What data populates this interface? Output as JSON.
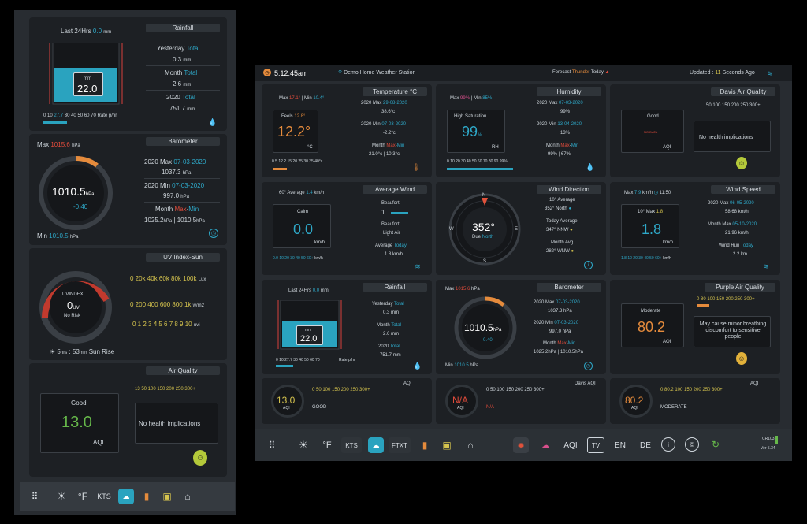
{
  "left": {
    "rainfall": {
      "title": "Rainfall",
      "last24_label": "Last 24Hrs",
      "last24_value": "0.0",
      "last24_unit": "mm",
      "gauge_unit": "mm",
      "gauge_value": "22.0",
      "scale": [
        "0",
        "10",
        "27.7",
        "30",
        "40",
        "50",
        "60",
        "70"
      ],
      "scale_label": "Rate p/hr",
      "yesterday_label": "Yesterday",
      "yesterday_total": "Total",
      "yesterday_value": "0.3",
      "month_label": "Month",
      "month_total": "Total",
      "month_value": "2.6",
      "year_label": "2020",
      "year_total": "Total",
      "year_value": "751.7",
      "unit": "mm"
    },
    "barometer": {
      "title": "Barometer",
      "max_label": "Max",
      "max_value": "1015.6",
      "unit": "hPa",
      "value": "1010.5",
      "value_unit": "hPa",
      "trend": "-0.40",
      "min_label": "Min",
      "min_value": "1010.5",
      "year_max_label": "2020 Max",
      "year_max_date": "07-03-2020",
      "year_max_value": "1037.3",
      "year_min_label": "2020 Min",
      "year_min_date": "07-03-2020",
      "year_min_value": "997.0",
      "month_label": "Month",
      "month_max": "Max",
      "month_sep": "-",
      "month_min": "Min",
      "month_max_value": "1025.2",
      "month_min_value": "1010.5",
      "sep": "|"
    },
    "uv": {
      "title": "UV Index-Sun",
      "gauge_title": "UVINDEX",
      "value": "0",
      "value_unit": "UVI",
      "risk": "No Risk",
      "solar_scale": "0 20k 40k 60k 80k 100k",
      "solar_unit": "Lux",
      "rad_scale": "0 200 400 600 800 1k",
      "rad_unit": "w/m2",
      "uvi_scale": "0 1 2 3 4 5 6 7 8 9 10",
      "uvi_unit": "uvi",
      "sun_hours": "5",
      "sun_hours_unit": "hrs",
      "sun_mins": "53",
      "sun_mins_unit": "min",
      "sun_label": "Sun Rise"
    },
    "air": {
      "title": "Air Quality",
      "status": "Good",
      "value": "13.0",
      "unit": "AQI",
      "scale": "13 50 100 150 200 250 300+",
      "message": "No health implications"
    },
    "toolbar": [
      "apps-icon",
      "sun-icon",
      "fahrenheit-button",
      "kts-button",
      "weather-icon",
      "chart-icon",
      "calendar-icon",
      "house-icon"
    ],
    "toolbar_f": "°F",
    "toolbar_kts": "KTS"
  },
  "right": {
    "header": {
      "time": "5:12:45am",
      "station": "Demo Home Weather Station",
      "forecast_label": "Forecast",
      "forecast_value": "Thunder",
      "forecast_day": "Today",
      "updated_label": "Updated :",
      "updated_value": "11",
      "updated_suffix": "Seconds Ago"
    },
    "temperature": {
      "title": "Temperature °C",
      "max_label": "Max",
      "max_value": "17.1°",
      "min_label": "Min",
      "min_value": "10.4°",
      "sep": "|",
      "feels_label": "Feels",
      "feels_value": "12.8°",
      "value": "12.2°",
      "unit": "°C",
      "scale": "0 5 12.2 15 20 25 30 35 40°c",
      "year_max_label": "2020 Max",
      "year_max_date": "29-08-2020",
      "year_max_value": "38.6°c",
      "year_min_label": "2020 Min",
      "year_min_date": "07-03-2020",
      "year_min_value": "-2.2°c",
      "month_label": "Month",
      "month_max": "Max",
      "month_min": "Min",
      "month_value": "21.0°c | 10.3°c"
    },
    "humidity": {
      "title": "Humidity",
      "max_label": "Max",
      "max_value": "99%",
      "min_label": "Min",
      "min_value": "85%",
      "sep": "|",
      "gauge_label": "High Saturation",
      "value": "99",
      "value_unit": "%",
      "value_sub": "RH",
      "scale": "0 10 20 30 40 50 60 70 80 90 99%",
      "year_max_label": "2020 Max",
      "year_max_date": "07-03-2020",
      "year_max_value": "99%",
      "year_min_label": "2020 Min",
      "year_min_date": "13-04-2020",
      "year_min_value": "13%",
      "month_label": "Month",
      "month_max": "Max",
      "month_min": "Min",
      "month_value": "99% | 67%"
    },
    "davis_air": {
      "title": "Davis Air Quality",
      "scale": "50 100 150 200 250 300+",
      "status": "Good",
      "no_data": "NO DATA",
      "unit": "AQI",
      "message": "No health implications"
    },
    "avg_wind": {
      "title": "Average Wind",
      "avg_label": "60° Average",
      "avg_value": "1.4",
      "avg_unit": "km/h",
      "calm": "Calm",
      "value": "0.0",
      "unit": "km/h",
      "scale": "0.0 10 20 30 40 50 60+",
      "scale_unit": "km/h",
      "beaufort_label": "Beaufort",
      "beaufort_value": "1",
      "beaufort2_label": "Beaufort",
      "beaufort_desc": "Light Air",
      "today_label": "Average",
      "today_value": "Today",
      "today_speed": "1.8",
      "today_unit": "km/h"
    },
    "wind_dir": {
      "title": "Wind Direction",
      "value": "352°",
      "due_label": "Due",
      "due_value": "North",
      "avg10_label": "10° Average",
      "avg10_value": "352°",
      "avg10_dir": "North",
      "today_label": "Today Average",
      "today_value": "347°",
      "today_dir": "NNW",
      "month_label": "Month Avg",
      "month_value": "282°",
      "month_dir": "WNW",
      "n": "N",
      "s": "S",
      "e": "E",
      "w": "W"
    },
    "wind_speed": {
      "title": "Wind Speed",
      "max_label": "Max",
      "max_value": "7.9",
      "max_unit": "km/h",
      "max_time": "11:50",
      "avg_label": "10° Max",
      "avg_value": "1.8",
      "value": "1.8",
      "unit": "km/h",
      "scale": "1.8 10 20 30 40 50 60+",
      "scale_unit": "km/h",
      "year_max_label": "2020 Max",
      "year_max_date": "06-05-2020",
      "year_max_value": "58.68",
      "year_max_unit": "km/h",
      "month_max_label": "Month Max",
      "month_max_date": "05-10-2020",
      "month_max_value": "21.96",
      "month_max_unit": "km/h",
      "run_label": "Wind Run",
      "run_today": "Today",
      "run_value": "2.2",
      "run_unit": "km"
    },
    "rainfall": {
      "title": "Rainfall",
      "last24_label": "Last 24Hrs",
      "last24_value": "0.0",
      "last24_unit": "mm",
      "gauge_unit": "mm",
      "gauge_value": "22.0",
      "scale": "0 10 27.7 30 40 50 60 70",
      "scale_label": "Rate p/hr",
      "yesterday_label": "Yesterday",
      "yesterday_total": "Total",
      "yesterday_value": "0.3",
      "month_label": "Month",
      "month_total": "Total",
      "month_value": "2.6",
      "year_label": "2020",
      "year_total": "Total",
      "year_value": "751.7",
      "unit": "mm"
    },
    "barometer": {
      "title": "Barometer",
      "max_label": "Max",
      "max_value": "1015.6",
      "unit": "hPa",
      "value": "1010.5",
      "value_unit": "hPa",
      "trend": "-0.40",
      "min_label": "Min",
      "min_value": "1010.5",
      "year_max_label": "2020 Max",
      "year_max_date": "07-03-2020",
      "year_max_value": "1037.3",
      "year_min_label": "2020 Min",
      "year_min_date": "07-03-2020",
      "year_min_value": "997.0",
      "month_label": "Month",
      "month_max": "Max",
      "month_min": "Min",
      "month_value": "1025.2",
      "month_value2": "1010.5"
    },
    "purple_air": {
      "title": "Purple Air Quality",
      "scale": "0 80 100 150 200 250 300+",
      "status": "Moderate",
      "value": "80.2",
      "unit": "AQI",
      "message": "May cause minor breathing discomfort to sensitive people"
    },
    "mini_aqi_1": {
      "title": "AQI",
      "value": "13.0",
      "unit": "AQI",
      "scale": "0 50 100 150 200 250 300+",
      "status": "GOOD"
    },
    "mini_aqi_2": {
      "title": "Davis AQI",
      "value": "N/A",
      "unit": "AQI",
      "scale": "0 50 100 150 200 250 300+",
      "status": "N/A"
    },
    "mini_aqi_3": {
      "title": "AQI",
      "value": "80.2",
      "unit": "AQI",
      "scale": "0 80.2 100 150 200 250 300+",
      "status": "MODERATE"
    },
    "toolbar": {
      "f": "°F",
      "kts": "KTS",
      "ftxt": "FTXT",
      "aqi": "AQI",
      "tv": "TV",
      "en": "EN",
      "de": "DE",
      "ver_label": "CR103",
      "version": "Ver 5.34"
    }
  }
}
